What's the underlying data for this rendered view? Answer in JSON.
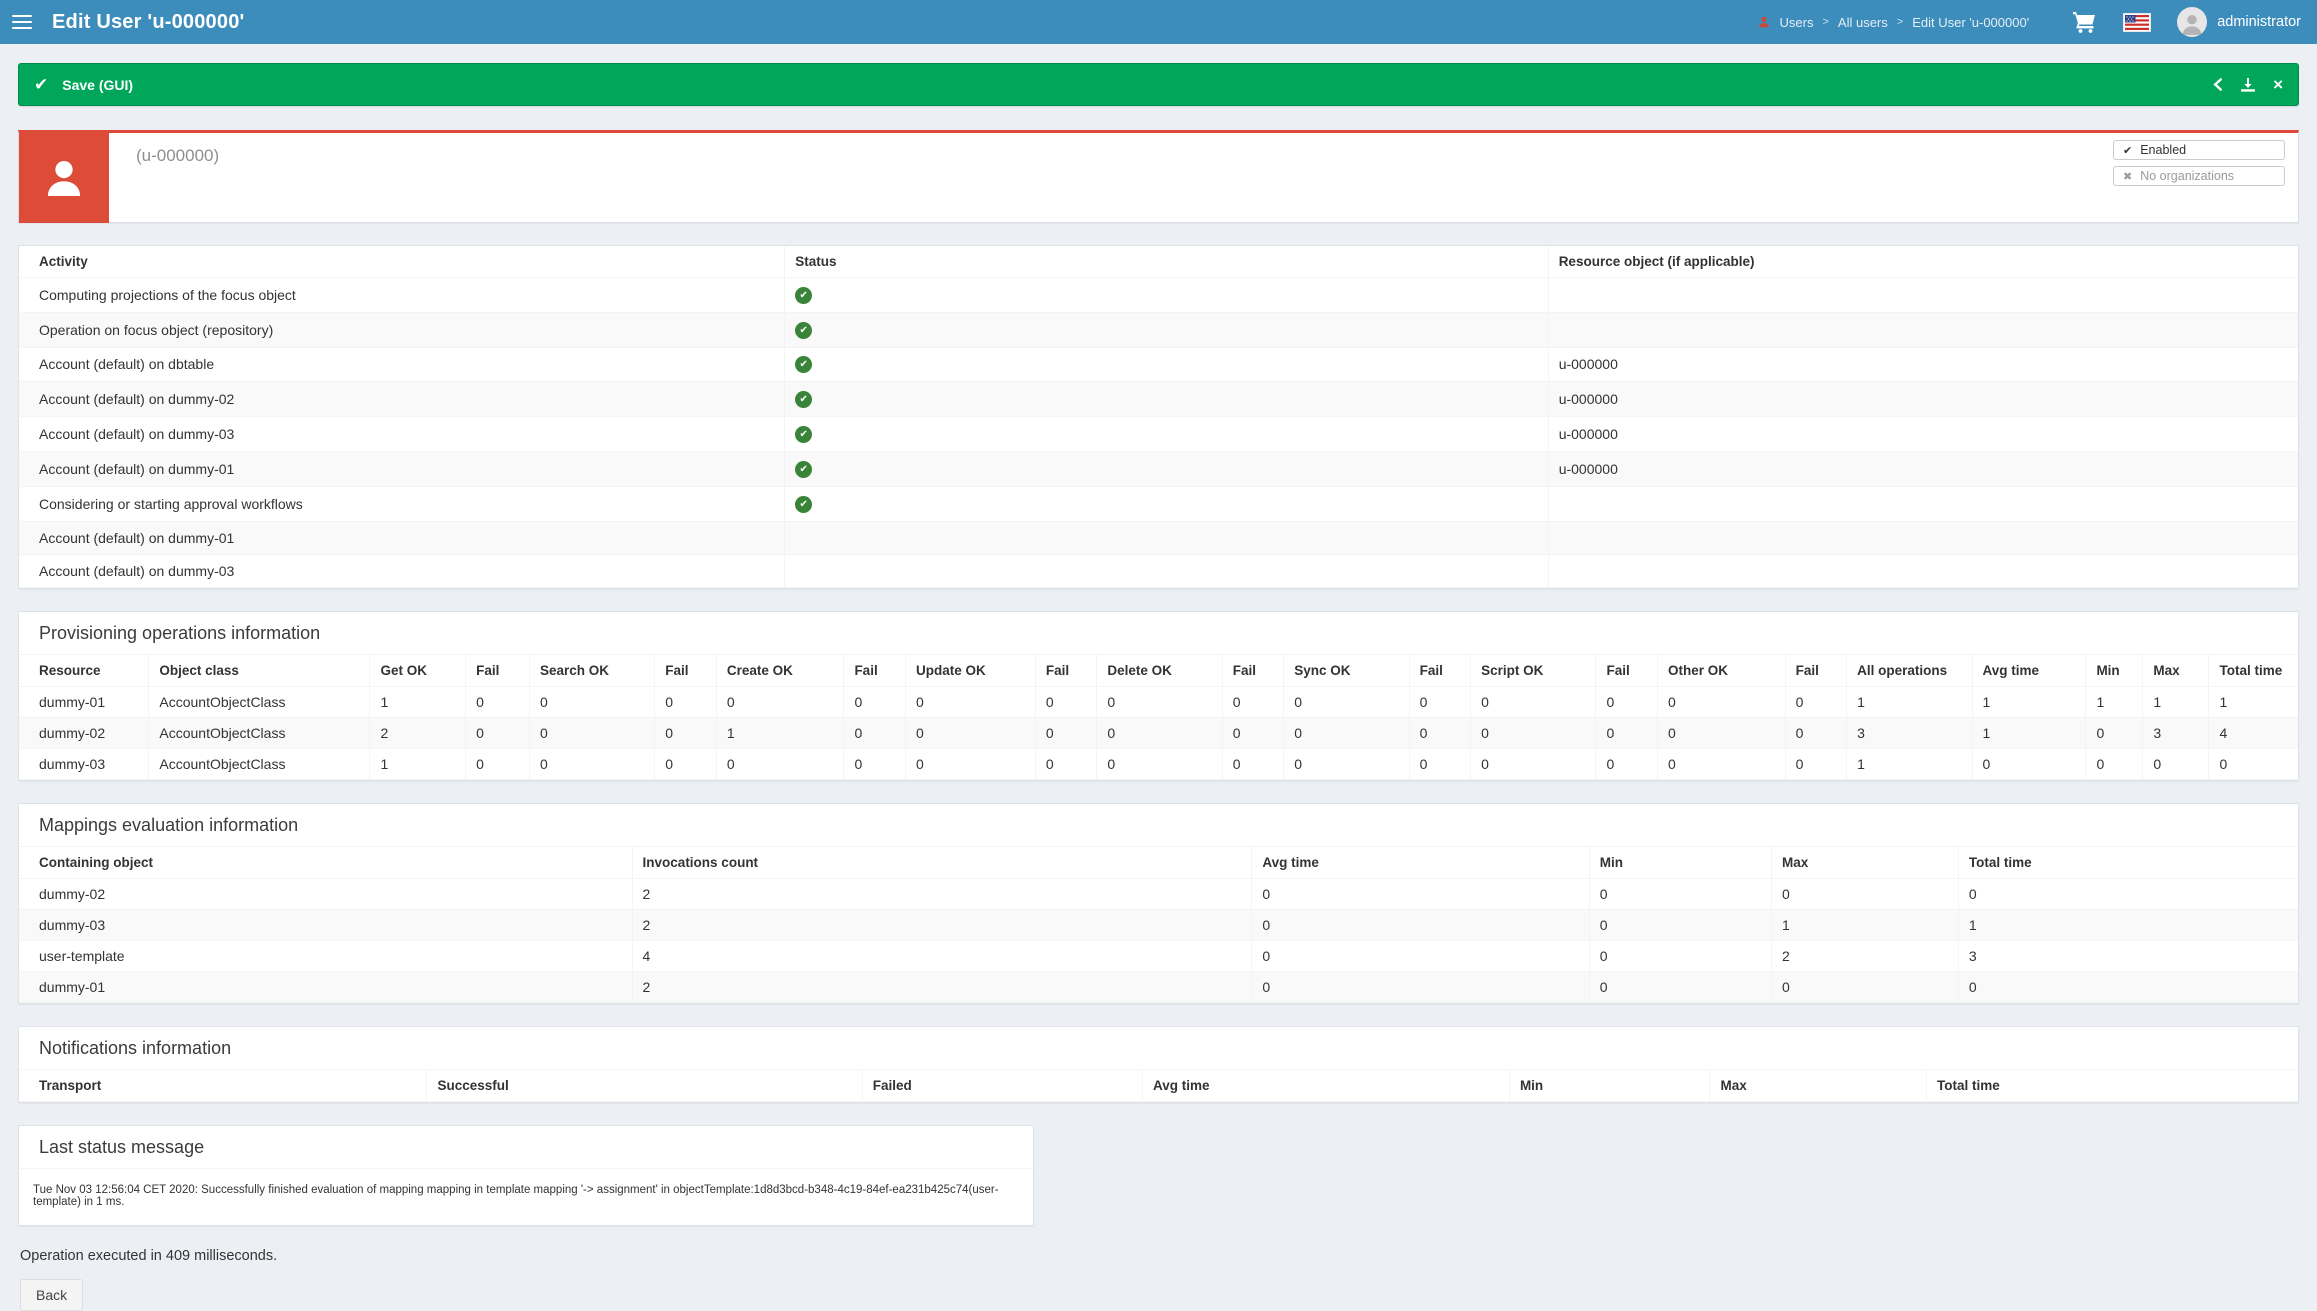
{
  "colors": {
    "navbar_blue": "#3c8dbc",
    "success_green": "#00a65a",
    "danger_red": "#dd4b39",
    "status_check_green": "#398439",
    "body_bg": "#ecf0f5"
  },
  "navbar": {
    "title": "Edit User 'u-000000'",
    "breadcrumb": {
      "items": [
        "Users",
        "All users",
        "Edit User 'u-000000'"
      ],
      "separator": ">"
    },
    "username": "administrator"
  },
  "feedback": {
    "title": "Save (GUI)",
    "check_icon": "✔",
    "close_icon": "×"
  },
  "summary": {
    "display_name": "(u-000000)",
    "tag_enabled": "Enabled",
    "tag_enabled_icon": "✔",
    "tag_orgs": "No organizations",
    "tag_orgs_icon": "✖"
  },
  "activity": {
    "columns": [
      "Activity",
      "Status",
      "Resource object (if applicable)"
    ],
    "rows": [
      [
        "Computing projections of the focus object",
        "icon:success",
        ""
      ],
      [
        "Operation on focus object (repository)",
        "icon:success",
        ""
      ],
      [
        "Account (default) on dbtable",
        "icon:success",
        "u-000000"
      ],
      [
        "Account (default) on dummy-02",
        "icon:success",
        "u-000000"
      ],
      [
        "Account (default) on dummy-03",
        "icon:success",
        "u-000000"
      ],
      [
        "Account (default) on dummy-01",
        "icon:success",
        "u-000000"
      ],
      [
        "Considering or starting approval workflows",
        "icon:success",
        ""
      ],
      [
        "Account (default) on dummy-01",
        "",
        ""
      ],
      [
        "Account (default) on dummy-03",
        "",
        ""
      ]
    ]
  },
  "provisioning": {
    "title": "Provisioning operations information",
    "columns": [
      "Resource",
      "Object class",
      "Get OK",
      "Fail",
      "Search OK",
      "Fail",
      "Create OK",
      "Fail",
      "Update OK",
      "Fail",
      "Delete OK",
      "Fail",
      "Sync OK",
      "Fail",
      "Script OK",
      "Fail",
      "Other OK",
      "Fail",
      "All operations",
      "Avg time",
      "Min",
      "Max",
      "Total time"
    ],
    "rows": [
      [
        "dummy-01",
        "AccountObjectClass",
        1,
        0,
        0,
        0,
        0,
        0,
        0,
        0,
        0,
        0,
        0,
        0,
        0,
        0,
        0,
        0,
        1,
        1,
        1,
        1,
        1
      ],
      [
        "dummy-02",
        "AccountObjectClass",
        2,
        0,
        0,
        0,
        1,
        0,
        0,
        0,
        0,
        0,
        0,
        0,
        0,
        0,
        0,
        0,
        3,
        1,
        0,
        3,
        4
      ],
      [
        "dummy-03",
        "AccountObjectClass",
        1,
        0,
        0,
        0,
        0,
        0,
        0,
        0,
        0,
        0,
        0,
        0,
        0,
        0,
        0,
        0,
        1,
        0,
        0,
        0,
        0
      ]
    ]
  },
  "mappings": {
    "title": "Mappings evaluation information",
    "columns": [
      "Containing object",
      "Invocations count",
      "Avg time",
      "Min",
      "Max",
      "Total time"
    ],
    "rows": [
      [
        "dummy-02",
        2,
        0,
        0,
        0,
        0
      ],
      [
        "dummy-03",
        2,
        0,
        0,
        1,
        1
      ],
      [
        "user-template",
        4,
        0,
        0,
        2,
        3
      ],
      [
        "dummy-01",
        2,
        0,
        0,
        0,
        0
      ]
    ]
  },
  "notifications": {
    "title": "Notifications information",
    "columns": [
      "Transport",
      "Successful",
      "Failed",
      "Avg time",
      "Min",
      "Max",
      "Total time"
    ],
    "rows": []
  },
  "last_status": {
    "title": "Last status message",
    "message": "Tue Nov 03 12:56:04 CET 2020: Successfully finished evaluation of mapping mapping in template mapping '-> assignment' in objectTemplate:1d8d3bcd-b348-4c19-84ef-ea231b425c74(user-template) in 1 ms."
  },
  "footer": {
    "execution_note": "Operation executed in 409 milliseconds.",
    "back_label": "Back"
  }
}
